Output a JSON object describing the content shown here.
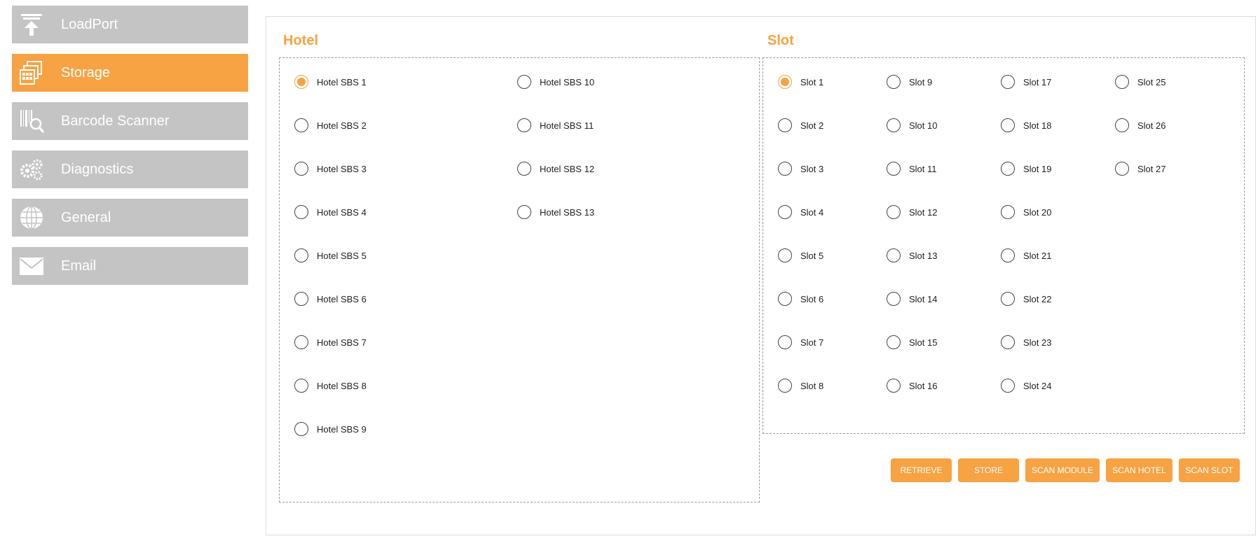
{
  "sidebar": {
    "items": [
      {
        "label": "LoadPort",
        "icon": "loadport-upload-icon"
      },
      {
        "label": "Storage",
        "icon": "storage-stack-icon"
      },
      {
        "label": "Barcode Scanner",
        "icon": "barcode-scanner-icon"
      },
      {
        "label": "Diagnostics",
        "icon": "gears-icon"
      },
      {
        "label": "General",
        "icon": "globe-icon"
      },
      {
        "label": "Email",
        "icon": "envelope-icon"
      }
    ],
    "active": "Storage"
  },
  "hotel": {
    "title": "Hotel",
    "selected": "Hotel SBS 1",
    "options": [
      "Hotel SBS 1",
      "Hotel SBS 2",
      "Hotel SBS 3",
      "Hotel SBS 4",
      "Hotel SBS 5",
      "Hotel SBS 6",
      "Hotel SBS 7",
      "Hotel SBS 8",
      "Hotel SBS 9",
      "Hotel SBS 10",
      "Hotel SBS 11",
      "Hotel SBS 12",
      "Hotel SBS 13"
    ]
  },
  "slot": {
    "title": "Slot",
    "selected": "Slot 1",
    "options": [
      "Slot 1",
      "Slot 2",
      "Slot 3",
      "Slot 4",
      "Slot 5",
      "Slot 6",
      "Slot 7",
      "Slot 8",
      "Slot 9",
      "Slot 10",
      "Slot 11",
      "Slot 12",
      "Slot 13",
      "Slot 14",
      "Slot 15",
      "Slot 16",
      "Slot 17",
      "Slot 18",
      "Slot 19",
      "Slot 20",
      "Slot 21",
      "Slot 22",
      "Slot 23",
      "Slot 24",
      "Slot 25",
      "Slot 26",
      "Slot 27"
    ]
  },
  "actions": {
    "retrieve": "RETRIEVE",
    "store": "STORE",
    "scan_module": "SCAN MODULE",
    "scan_hotel": "SCAN HOTEL",
    "scan_slot": "SCAN SLOT"
  },
  "colors": {
    "accent": "#f7a243",
    "nav_inactive": "#c4c4c4"
  }
}
